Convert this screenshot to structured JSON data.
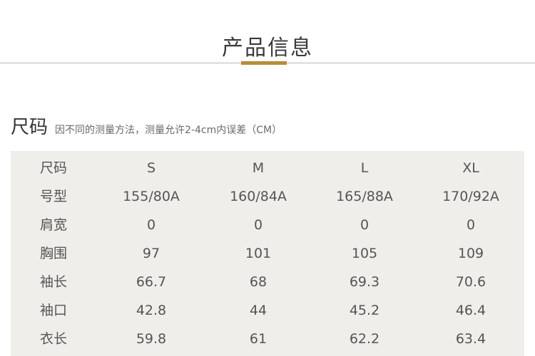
{
  "header": {
    "title": "产品信息"
  },
  "size_section": {
    "title": "尺码",
    "note": "因不同的测量方法，测量允许2-4cm内误差（CM）"
  },
  "table": {
    "header": {
      "label": "尺码",
      "sizes": [
        "S",
        "M",
        "L",
        "XL"
      ]
    },
    "rows": [
      {
        "label": "号型",
        "values": [
          "155/80A",
          "160/84A",
          "165/88A",
          "170/92A"
        ]
      },
      {
        "label": "肩宽",
        "values": [
          "0",
          "0",
          "0",
          "0"
        ]
      },
      {
        "label": "胸围",
        "values": [
          "97",
          "101",
          "105",
          "109"
        ]
      },
      {
        "label": "袖长",
        "values": [
          "66.7",
          "68",
          "69.3",
          "70.6"
        ]
      },
      {
        "label": "袖口",
        "values": [
          "42.8",
          "44",
          "45.2",
          "46.4"
        ]
      },
      {
        "label": "衣长",
        "values": [
          "59.8",
          "61",
          "62.2",
          "63.4"
        ]
      }
    ]
  }
}
